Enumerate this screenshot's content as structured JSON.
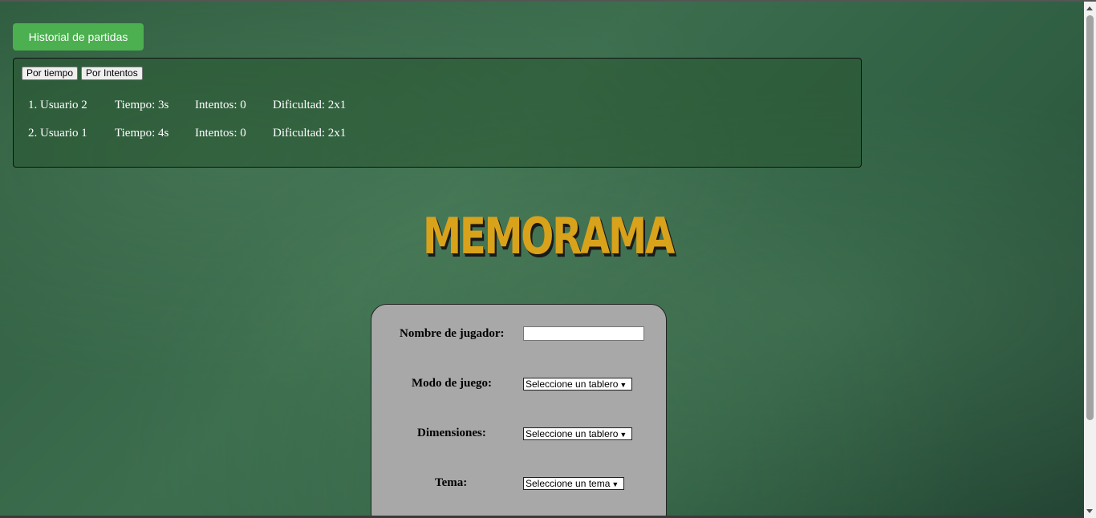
{
  "history_button": "Historial de partidas",
  "history": {
    "sort_time": "Por tiempo",
    "sort_attempts": "Por Intentos",
    "rows": [
      {
        "rank": "1. Usuario 2",
        "time": "Tiempo: 3s",
        "attempts": "Intentos: 0",
        "difficulty": "Dificultad: 2x1"
      },
      {
        "rank": "2. Usuario 1",
        "time": "Tiempo: 4s",
        "attempts": "Intentos: 0",
        "difficulty": "Dificultad: 2x1"
      }
    ]
  },
  "title": "MEMORAMA",
  "form": {
    "player_name_label": "Nombre de jugador:",
    "player_name_value": "",
    "mode_label": "Modo de juego:",
    "mode_value": "Seleccione un tablero",
    "dimensions_label": "Dimensiones:",
    "dimensions_value": "Seleccione un tablero",
    "theme_label": "Tema:",
    "theme_value": "Seleccione un tema"
  },
  "colors": {
    "accent_green": "#4caf50",
    "title_gold": "#d9a21b",
    "chalkboard": "#3c6e4e",
    "form_bg": "#a8a8a8"
  }
}
